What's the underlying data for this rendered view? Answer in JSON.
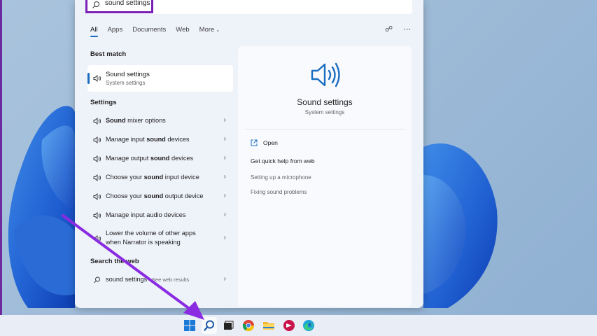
{
  "search": {
    "query": "sound settings"
  },
  "filters": {
    "tabs": [
      "All",
      "Apps",
      "Documents",
      "Web",
      "More"
    ],
    "icons": [
      "share-icon",
      "more-options-icon"
    ]
  },
  "sections": {
    "best_match": "Best match",
    "settings": "Settings",
    "search_web": "Search the web"
  },
  "best_match": {
    "title": "Sound settings",
    "subtitle": "System settings",
    "icon": "speaker-icon"
  },
  "settings_items": [
    {
      "pre": "",
      "bold": "Sound",
      "post": " mixer options"
    },
    {
      "pre": "Manage input ",
      "bold": "sound",
      "post": " devices"
    },
    {
      "pre": "Manage output ",
      "bold": "sound",
      "post": " devices"
    },
    {
      "pre": "Choose your ",
      "bold": "sound",
      "post": " input device"
    },
    {
      "pre": "Choose your ",
      "bold": "sound",
      "post": " output device"
    },
    {
      "pre": "Manage input audio devices",
      "bold": "",
      "post": ""
    },
    {
      "pre": "Lower the volume of other apps when Narrator is speaking",
      "bold": "",
      "post": ""
    }
  ],
  "web_item": {
    "query": "sound settings",
    "suffix": " - See web results"
  },
  "detail": {
    "title": "Sound settings",
    "subtitle": "System settings",
    "open_label": "Open",
    "help_title": "Get quick help from web",
    "links": [
      "Setting up a microphone",
      "Fixing sound problems"
    ]
  },
  "taskbar": {
    "icons": [
      "windows-start-icon",
      "search-icon",
      "task-view-icon",
      "chrome-icon",
      "file-explorer-icon",
      "app-icon",
      "edge-icon"
    ]
  },
  "colors": {
    "accent": "#1a6ec1",
    "highlight": "#7a22b5",
    "arrow": "#8a2be2"
  }
}
